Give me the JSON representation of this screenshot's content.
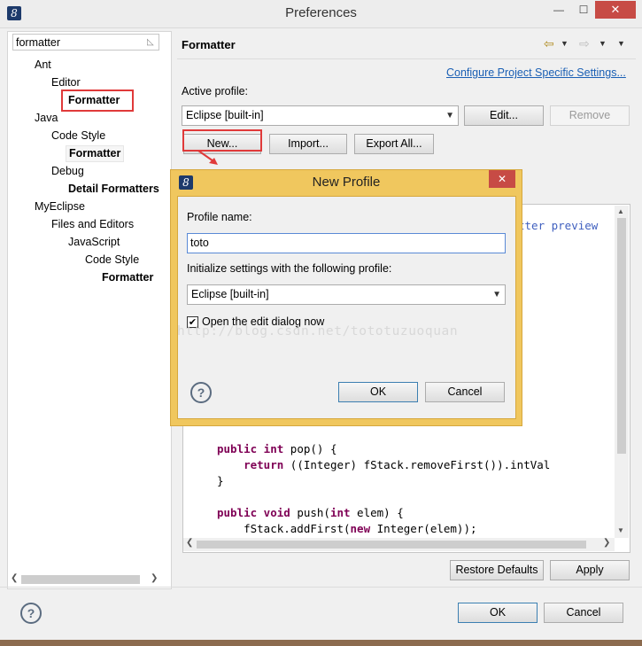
{
  "window": {
    "title": "Preferences",
    "minimize": "—",
    "maximize": "☐",
    "close": "✕"
  },
  "filter": {
    "value": "formatter"
  },
  "tree": [
    {
      "label": "Ant"
    },
    {
      "label": "Editor"
    },
    {
      "label": "Formatter"
    },
    {
      "label": "Java"
    },
    {
      "label": "Code Style"
    },
    {
      "label": "Formatter"
    },
    {
      "label": "Debug"
    },
    {
      "label": "Detail Formatters"
    },
    {
      "label": "MyEclipse"
    },
    {
      "label": "Files and Editors"
    },
    {
      "label": "JavaScript"
    },
    {
      "label": "Code Style"
    },
    {
      "label": "Formatter"
    }
  ],
  "page": {
    "heading": "Formatter",
    "configure_link": "Configure Project Specific Settings...",
    "active_profile_label": "Active profile:",
    "active_profile_value": "Eclipse [built-in]",
    "edit_button": "Edit...",
    "remove_button": "Remove",
    "new_button": "New...",
    "import_button": "Import...",
    "export_button": "Export All...",
    "preview_comment_fragment": "tter preview",
    "code": [
      "public int pop() {",
      "    return ((Integer) fStack.removeFirst()).intVal",
      "}",
      "",
      "public void push(int elem) {",
      "    fStack.addFirst(new Integer(elem));"
    ],
    "restore_defaults_button": "Restore Defaults",
    "apply_button": "Apply",
    "ok_button": "OK",
    "cancel_button": "Cancel"
  },
  "dialog": {
    "title": "New Profile",
    "close": "✕",
    "profile_name_label": "Profile name:",
    "profile_name_value": "toto",
    "init_label": "Initialize settings with the following profile:",
    "init_value": "Eclipse [built-in]",
    "open_edit_label": "Open the edit dialog now",
    "open_edit_checked": true,
    "ok_button": "OK",
    "cancel_button": "Cancel"
  },
  "watermark": "http://blog.csdn.net/tototuzuoquan",
  "colors": {
    "highlight": "#e03a3a",
    "dialog_frame": "#f0c75e",
    "link": "#1a5fb4"
  }
}
